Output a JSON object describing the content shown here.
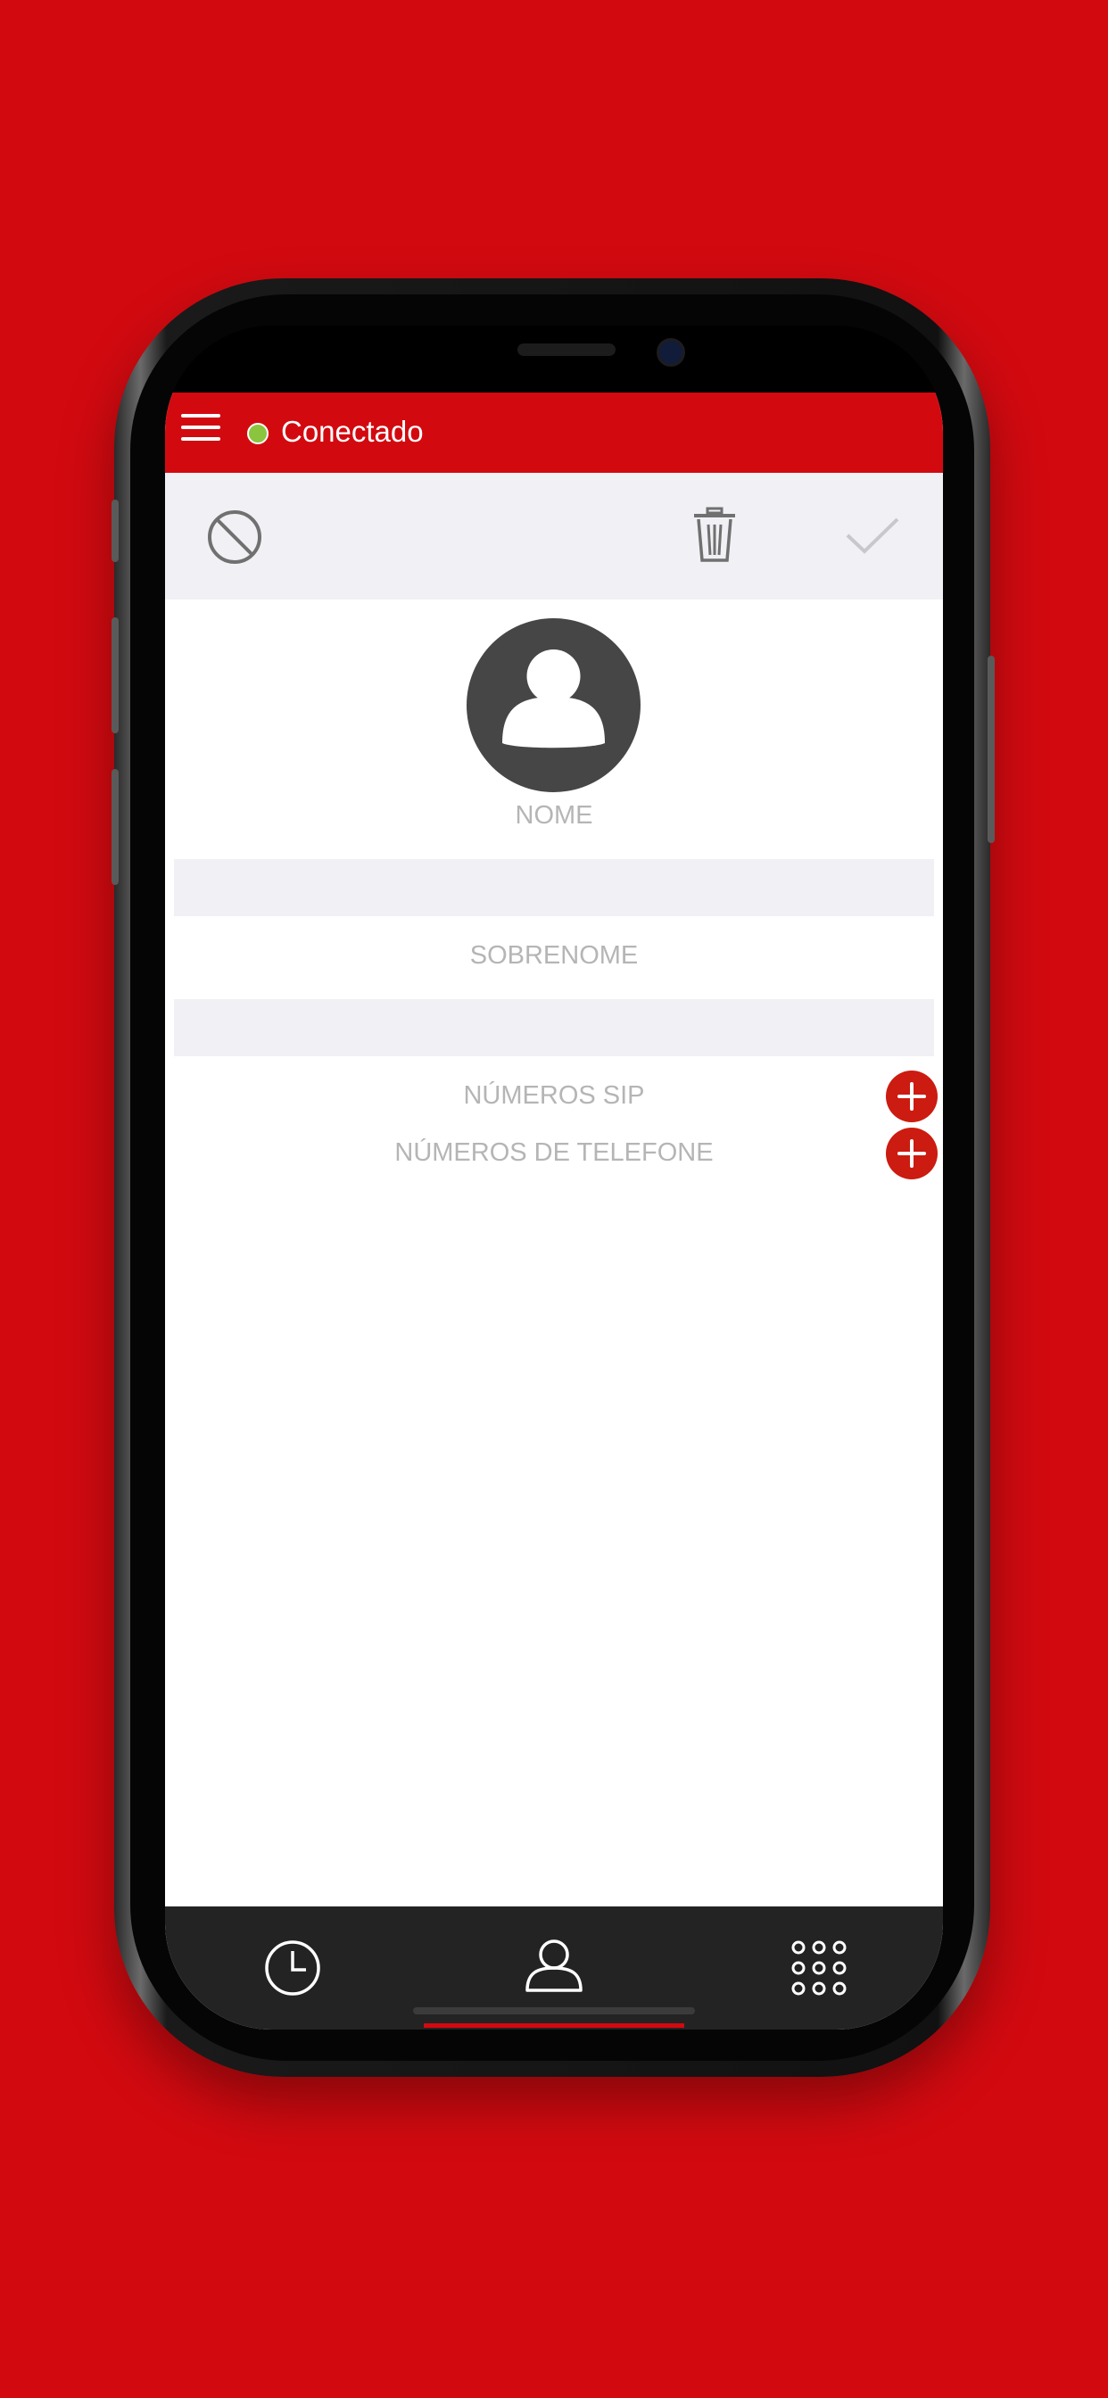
{
  "status": {
    "label": "Conectado",
    "dot_color": "#8bc53f"
  },
  "toolbar": {
    "icons": [
      "block-icon",
      "trash-icon",
      "checkmark-icon"
    ]
  },
  "contact": {
    "name_label": "NOME",
    "nickname_label": "SOBRENOME",
    "sip_label": "NÚMEROS SIP",
    "phone_label": "NÚMEROS DE TELEFONE"
  },
  "tabbar": {
    "icons": [
      "clock-icon",
      "person-icon",
      "keypad-icon"
    ],
    "active": "person-icon"
  },
  "colors": {
    "brand": "#d20a10",
    "add_button": "#cc1b10"
  }
}
